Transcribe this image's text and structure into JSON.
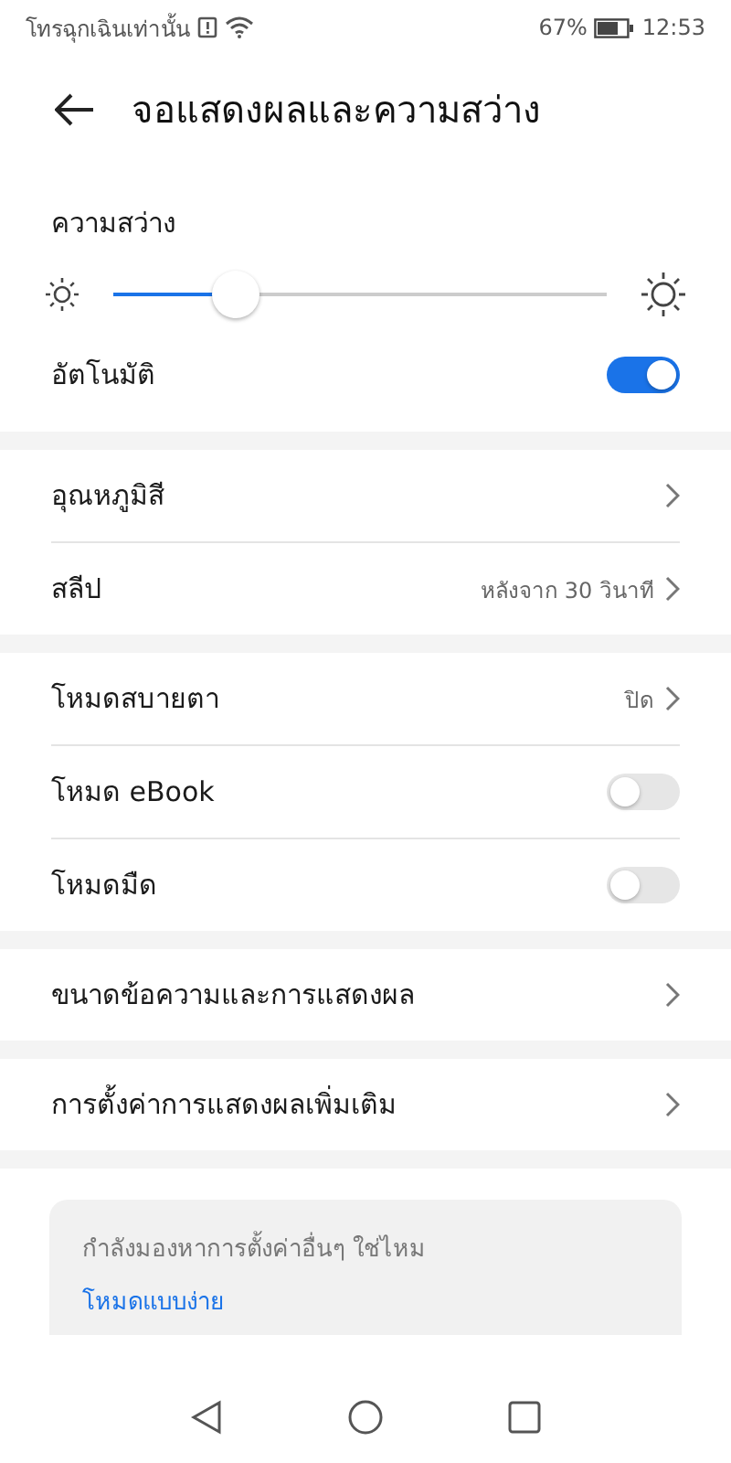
{
  "status_bar": {
    "carrier": "โทรฉุกเฉินเท่านั้น",
    "battery_percent": "67%",
    "time": "12:53"
  },
  "header": {
    "title": "จอแสดงผลและความสว่าง"
  },
  "brightness": {
    "label": "ความสว่าง",
    "level": 0.22,
    "auto_label": "อัตโนมัติ",
    "auto_on": true
  },
  "sections": [
    {
      "rows": [
        {
          "kind": "chevron",
          "label": "อุณหภูมิสี"
        },
        {
          "kind": "value",
          "label": "สลีป",
          "value": "หลังจาก 30 วินาที"
        }
      ]
    },
    {
      "rows": [
        {
          "kind": "value",
          "label": "โหมดสบายตา",
          "value": "ปิด"
        },
        {
          "kind": "toggle",
          "label": "โหมด eBook",
          "on": false
        },
        {
          "kind": "toggle",
          "label": "โหมดมืด",
          "on": false
        }
      ]
    },
    {
      "rows": [
        {
          "kind": "chevron",
          "label": "ขนาดข้อความและการแสดงผล"
        }
      ]
    },
    {
      "rows": [
        {
          "kind": "chevron",
          "label": "การตั้งค่าการแสดงผลเพิ่มเติม"
        }
      ]
    }
  ],
  "suggestion": {
    "text": "กำลังมองหาการตั้งค่าอื่นๆ ใช่ไหม",
    "link": "โหมดแบบง่าย"
  }
}
